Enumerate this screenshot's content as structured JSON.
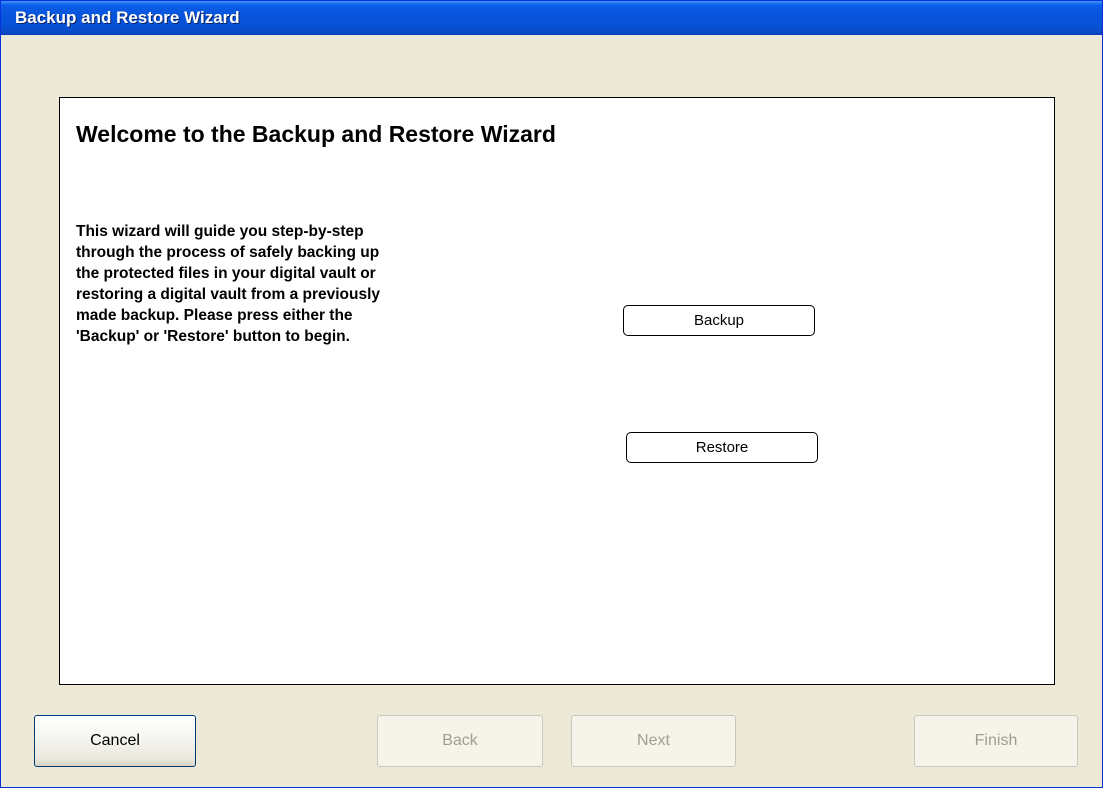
{
  "window": {
    "title": "Backup and Restore Wizard"
  },
  "content": {
    "heading": "Welcome to the Backup and Restore Wizard",
    "description_lines": [
      "This wizard will guide you step-by-step",
      "through the process of safely backing up",
      "the protected files in your digital vault or",
      "restoring a digital vault from a previously",
      "made backup. Please press either the",
      "'Backup' or 'Restore' button to begin."
    ],
    "backup_label": "Backup",
    "restore_label": "Restore"
  },
  "footer": {
    "cancel_label": "Cancel",
    "back_label": "Back",
    "next_label": "Next",
    "finish_label": "Finish",
    "back_enabled": false,
    "next_enabled": false,
    "finish_enabled": false
  },
  "colors": {
    "titlebar": "#0855dd",
    "window_bg": "#ece9d8",
    "panel_bg": "#ffffff",
    "disabled_text": "#a19d8f"
  }
}
